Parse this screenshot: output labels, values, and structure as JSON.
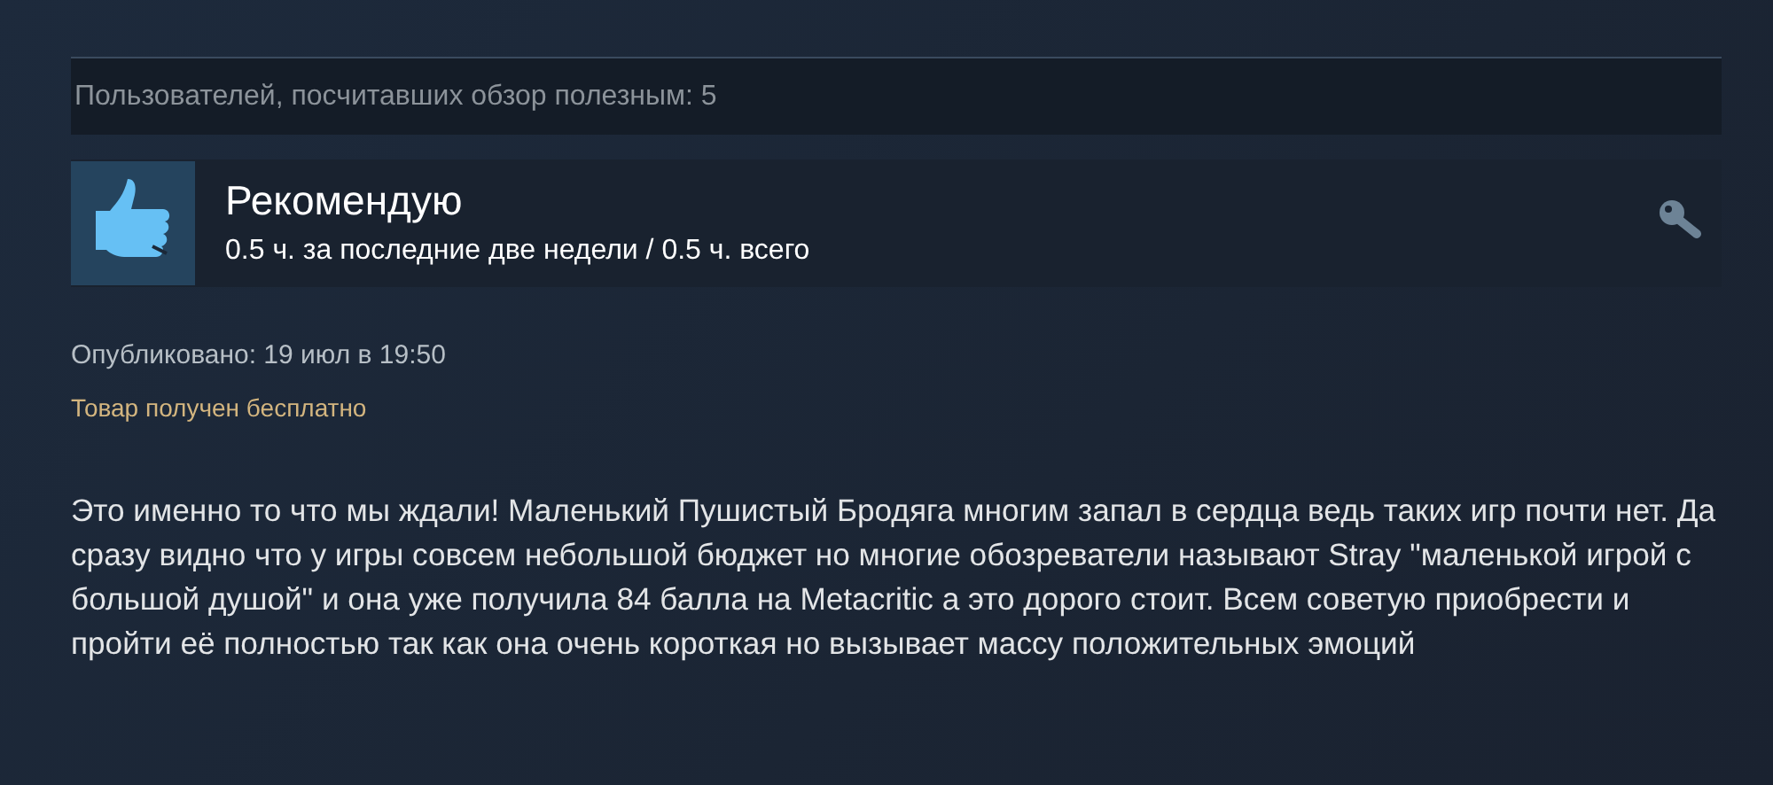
{
  "helpful": {
    "text": "Пользователей, посчитавших обзор полезным: 5"
  },
  "review": {
    "recommended": true,
    "verdict": "Рекомендую",
    "hours": "0.5 ч. за последние две недели / 0.5 ч. всего"
  },
  "posted": "Опубликовано: 19 июл в 19:50",
  "received_free": "Товар получен бесплатно",
  "body": "Это именно то что мы ждали! Маленький Пушистый Бродяга многим запал в сердца ведь таких игр почти нет. Да сразу видно что у игры совсем небольшой бюджет но многие обозреватели называют Stray \"маленькой игрой с большой душой\" и она уже получила 84 балла на Metacritic а это дорого стоит. Всем советую приобрести и пройти её полностью так как она очень короткая но вызывает массу положительных эмоций"
}
